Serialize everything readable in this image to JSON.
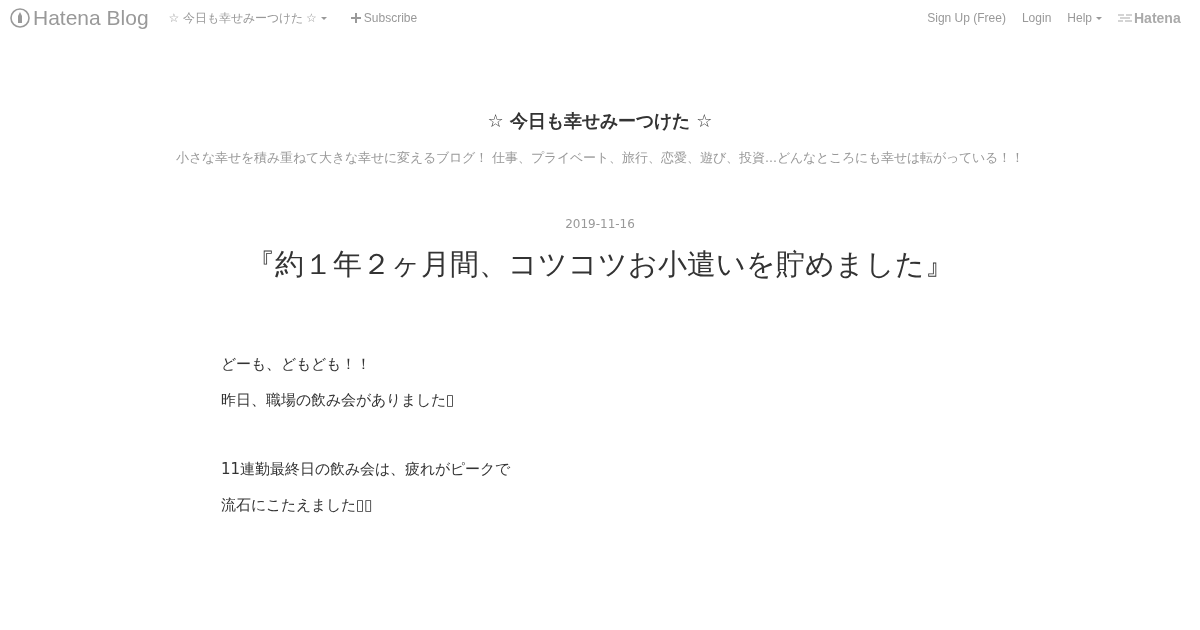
{
  "global_header": {
    "logo": "Hatena Blog",
    "blog_menu": "☆ 今日も幸せみーつけた ☆",
    "subscribe": "Subscribe",
    "links": [
      "Sign Up (Free)",
      "Login"
    ],
    "help": "Help",
    "brand": "Hatena"
  },
  "blog": {
    "title": "☆ 今日も幸せみーつけた ☆",
    "description": "小さな幸せを積み重ねて大きな幸せに変えるブログ！ 仕事、プライベート、旅行、恋愛、遊び、投資...どんなところにも幸せは転がっている！！"
  },
  "entry": {
    "date": "2019-11-16",
    "title": "『約１年２ヶ月間、コツコツお小遣いを貯めました』",
    "paragraph_groups": [
      [
        "どーも、どもども！！",
        "昨日、職場の飲み会がありました▯"
      ],
      [
        "11連勤最終日の飲み会は、疲れがピークで",
        "流石にこたえました▯▯"
      ]
    ]
  }
}
